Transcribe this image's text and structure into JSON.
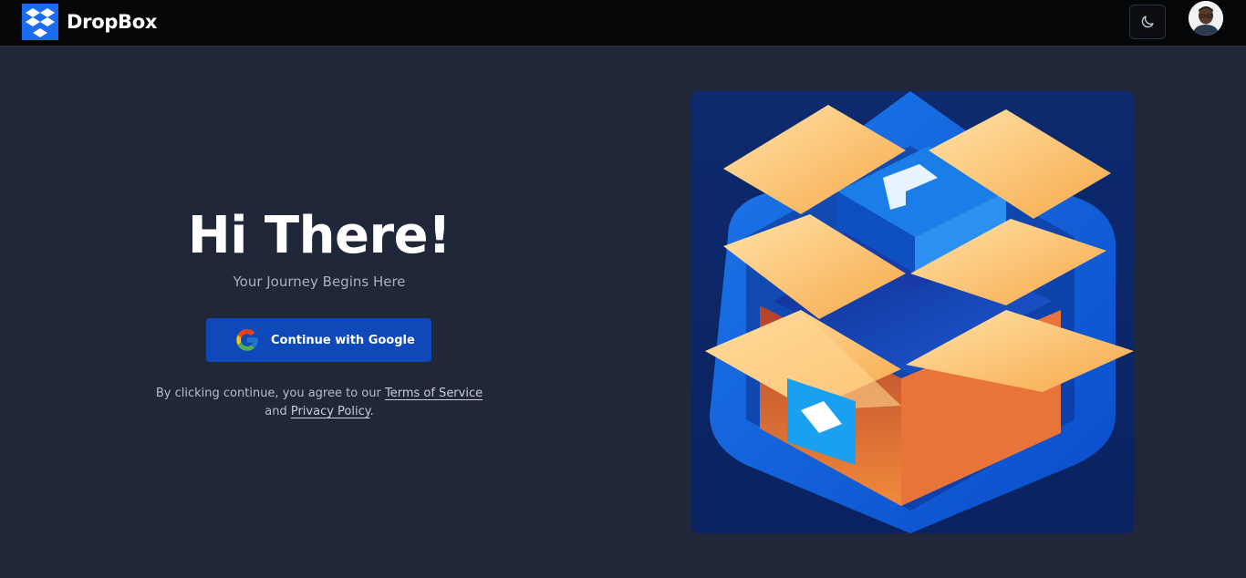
{
  "header": {
    "brand_name": "DropBox",
    "logo_icon": "dropbox-logo-icon",
    "theme_toggle_icon": "moon-icon",
    "avatar_icon": "user-avatar"
  },
  "hero": {
    "headline": "Hi There!",
    "subheadline": "Your Journey Begins Here",
    "google_button_label": "Continue with Google",
    "google_icon": "google-g-icon",
    "legal_prefix": "By clicking continue, you agree to our ",
    "terms_link": "Terms of Service",
    "legal_mid": " and ",
    "privacy_link": "Privacy Policy",
    "legal_suffix": "."
  },
  "illustration": {
    "description_icon": "open-box-illustration"
  },
  "colors": {
    "background": "#1f2738",
    "topbar": "#050608",
    "accent_blue": "#0f48b8",
    "brand_blue": "#1c6cf2"
  }
}
